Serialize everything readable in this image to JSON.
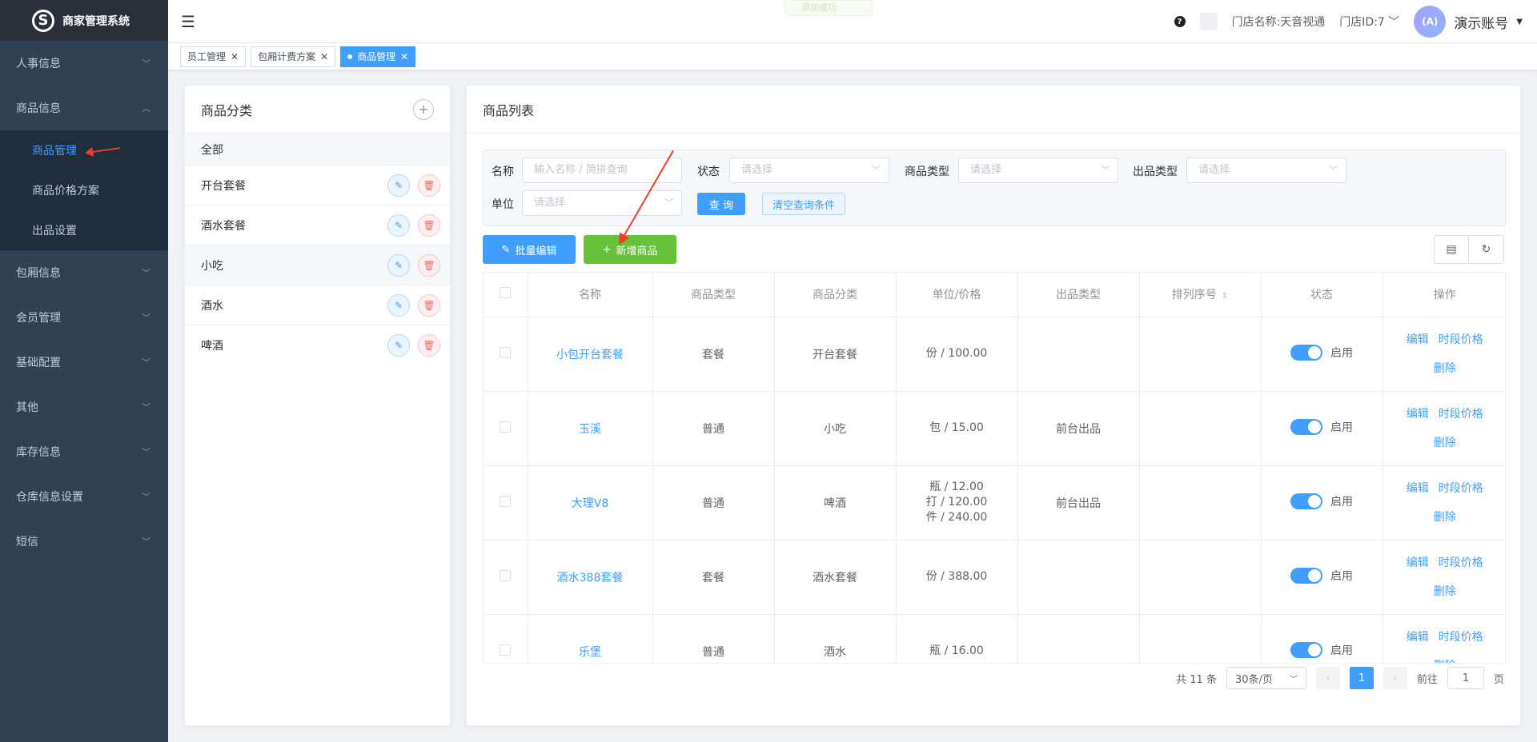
{
  "app": {
    "title": "商家管理系统"
  },
  "sidebar": {
    "items": [
      {
        "label": "人事信息"
      },
      {
        "label": "商品信息"
      },
      {
        "label": "包厢信息"
      },
      {
        "label": "会员管理"
      },
      {
        "label": "基础配置"
      },
      {
        "label": "其他"
      },
      {
        "label": "库存信息"
      },
      {
        "label": "仓库信息设置"
      },
      {
        "label": "短信"
      }
    ],
    "sub_items": [
      {
        "label": "商品管理"
      },
      {
        "label": "商品价格方案"
      },
      {
        "label": "出品设置"
      }
    ]
  },
  "topbar": {
    "faded_text": "添加成功",
    "store_name": "门店名称:天音视通",
    "store_id": "门店ID:7",
    "avatar_text": "(A)",
    "account": "演示账号"
  },
  "tags": [
    {
      "label": "员工管理"
    },
    {
      "label": "包厢计费方案"
    },
    {
      "label": "商品管理"
    }
  ],
  "category": {
    "title": "商品分类",
    "all": "全部",
    "items": [
      "开台套餐",
      "酒水套餐",
      "小吃",
      "酒水",
      "啤酒"
    ]
  },
  "list": {
    "title": "商品列表",
    "filters": {
      "name_label": "名称",
      "name_placeholder": "输入名称 / 简拼查询",
      "status_label": "状态",
      "status_placeholder": "请选择",
      "type_label": "商品类型",
      "type_placeholder": "请选择",
      "out_label": "出品类型",
      "out_placeholder": "请选择",
      "unit_label": "单位",
      "unit_placeholder": "请选择",
      "query_btn": "查 询",
      "clear_btn": "清空查询条件"
    },
    "batch_btn": "批量编辑",
    "add_btn": "新增商品",
    "columns": [
      "名称",
      "商品类型",
      "商品分类",
      "单位/价格",
      "出品类型",
      "排列序号",
      "状态",
      "操作"
    ],
    "rows": [
      {
        "name": "小包开台套餐",
        "type": "套餐",
        "category": "开台套餐",
        "price": [
          "份 / 100.00"
        ],
        "out": "",
        "order": "",
        "status": "启用"
      },
      {
        "name": "玉溪",
        "type": "普通",
        "category": "小吃",
        "price": [
          "包 / 15.00"
        ],
        "out": "前台出品",
        "order": "",
        "status": "启用"
      },
      {
        "name": "大理V8",
        "type": "普通",
        "category": "啤酒",
        "price": [
          "瓶 / 12.00",
          "打 / 120.00",
          "件 / 240.00"
        ],
        "out": "前台出品",
        "order": "",
        "status": "启用"
      },
      {
        "name": "酒水388套餐",
        "type": "套餐",
        "category": "酒水套餐",
        "price": [
          "份 / 388.00"
        ],
        "out": "",
        "order": "",
        "status": "启用"
      },
      {
        "name": "乐堡",
        "type": "普通",
        "category": "酒水",
        "price": [
          "瓶 / 16.00"
        ],
        "out": "",
        "order": "",
        "status": "启用"
      }
    ],
    "ops": {
      "edit": "编辑",
      "period_price": "时段价格",
      "delete": "删除"
    }
  },
  "pager": {
    "total": "共 11 条",
    "page_size": "30条/页",
    "current": "1",
    "goto_label": "前往",
    "goto_value": "1",
    "page_suffix": "页"
  },
  "colors": {
    "primary": "#409eff",
    "success": "#67c23a",
    "sidebar": "#304156",
    "danger": "#f56c6c"
  }
}
